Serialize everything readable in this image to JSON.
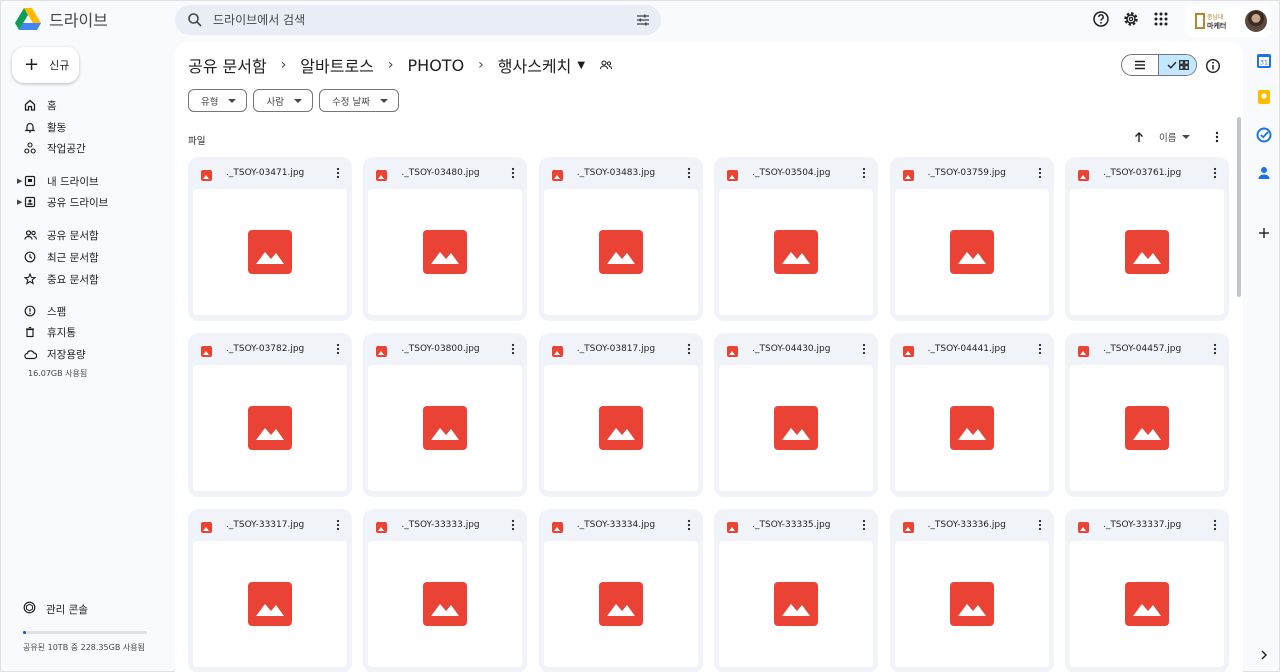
{
  "app": {
    "name": "드라이브"
  },
  "search": {
    "placeholder": "드라이브에서 검색"
  },
  "sidebar": {
    "new_label": "신규",
    "items": [
      {
        "label": "홈",
        "icon": "home-icon"
      },
      {
        "label": "활동",
        "icon": "bell-icon"
      },
      {
        "label": "작업공간",
        "icon": "workspaces-icon"
      },
      {
        "label": "내 드라이브",
        "icon": "my-drive-icon"
      },
      {
        "label": "공유 드라이브",
        "icon": "shared-drive-icon"
      },
      {
        "label": "공유 문서함",
        "icon": "people-icon"
      },
      {
        "label": "최근 문서함",
        "icon": "clock-icon"
      },
      {
        "label": "중요 문서함",
        "icon": "star-icon"
      },
      {
        "label": "스팸",
        "icon": "spam-icon"
      },
      {
        "label": "휴지통",
        "icon": "trash-icon"
      },
      {
        "label": "저장용량",
        "icon": "cloud-icon"
      }
    ],
    "storage_used": "16.07GB 사용됨",
    "admin_label": "관리 콘솔",
    "quota_text": "공유된 10TB 중 228.35GB 사용됨",
    "quota_fraction": 0.022
  },
  "breadcrumb": [
    "공유 문서함",
    "알바트로스",
    "PHOTO",
    "행사스케치"
  ],
  "filters": [
    "유형",
    "사람",
    "수정 날짜"
  ],
  "section_label": "파일",
  "sort_label": "이름",
  "files": [
    "._TSOY-03471.jpg",
    "._TSOY-03480.jpg",
    "._TSOY-03483.jpg",
    "._TSOY-03504.jpg",
    "._TSOY-03759.jpg",
    "._TSOY-03761.jpg",
    "._TSOY-03782.jpg",
    "._TSOY-03800.jpg",
    "._TSOY-03817.jpg",
    "._TSOY-04430.jpg",
    "._TSOY-04441.jpg",
    "._TSOY-04457.jpg",
    "._TSOY-33317.jpg",
    "._TSOY-33333.jpg",
    "._TSOY-33334.jpg",
    "._TSOY-33335.jpg",
    "._TSOY-33336.jpg",
    "._TSOY-33337.jpg"
  ],
  "account_brand": {
    "line1": "충남대",
    "line2": "마케터"
  },
  "colors": {
    "accent": "#0b57d0",
    "selected_view": "#c2e7ff",
    "image_icon": "#ea4335"
  }
}
